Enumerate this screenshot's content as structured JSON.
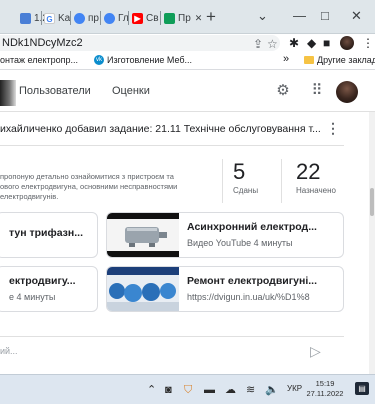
{
  "browser": {
    "tabs": [
      {
        "label": "1.2",
        "icon": "doc-icon",
        "color": "#4a7fd6"
      },
      {
        "label": "Ka",
        "icon": "google-icon",
        "color": "#4285f4"
      },
      {
        "label": "пр",
        "icon": "google-icon",
        "color": "#4285f4"
      },
      {
        "label": "Гл",
        "icon": "google-icon",
        "color": "#4285f4"
      },
      {
        "label": "Св",
        "icon": "youtube-icon",
        "color": "#ff0000"
      },
      {
        "label": "Пр",
        "icon": "classroom-icon",
        "color": "#0f9d58"
      }
    ],
    "new_tab": "+",
    "window_controls": {
      "minimize": "—",
      "maximize": "□",
      "close": "✕",
      "dropdown": "⌄"
    },
    "url": "NDk1NDcyMzc2",
    "bookmarks": [
      {
        "label": "онтаж електропр..."
      },
      {
        "label": "Изготовление Меб..."
      },
      {
        "label": "»"
      },
      {
        "label": "Другие закладки"
      }
    ]
  },
  "app": {
    "nav": {
      "people": "Пользователи",
      "grades": "Оценки"
    },
    "task": {
      "title": "ихайличенко добавил задание: 21.11 Технічне обслуговування т...",
      "description_lines": [
        "пропоную детально ознайомитися з пристроєм та",
        "ового електродвигуна, основними несправностями",
        "електродвигунів."
      ],
      "submitted_count": "5",
      "submitted_label": "Сданы",
      "assigned_count": "22",
      "assigned_label": "Назначено"
    },
    "attachments": [
      {
        "title": "тун трифазн..."
      },
      {
        "title": "Асинхронний електрод...",
        "subtitle": "Видео YouTube   4 минуты"
      },
      {
        "title": "ектродвигу...",
        "subtitle": "е   4 минуты"
      },
      {
        "title": "Ремонт електродвигуні...",
        "subtitle": "https://dvigun.in.ua/uk/%D1%8"
      }
    ],
    "comment_placeholder": "ий..."
  },
  "taskbar": {
    "lang": "УКР",
    "time": "15:19",
    "date": "27.11.2022"
  }
}
